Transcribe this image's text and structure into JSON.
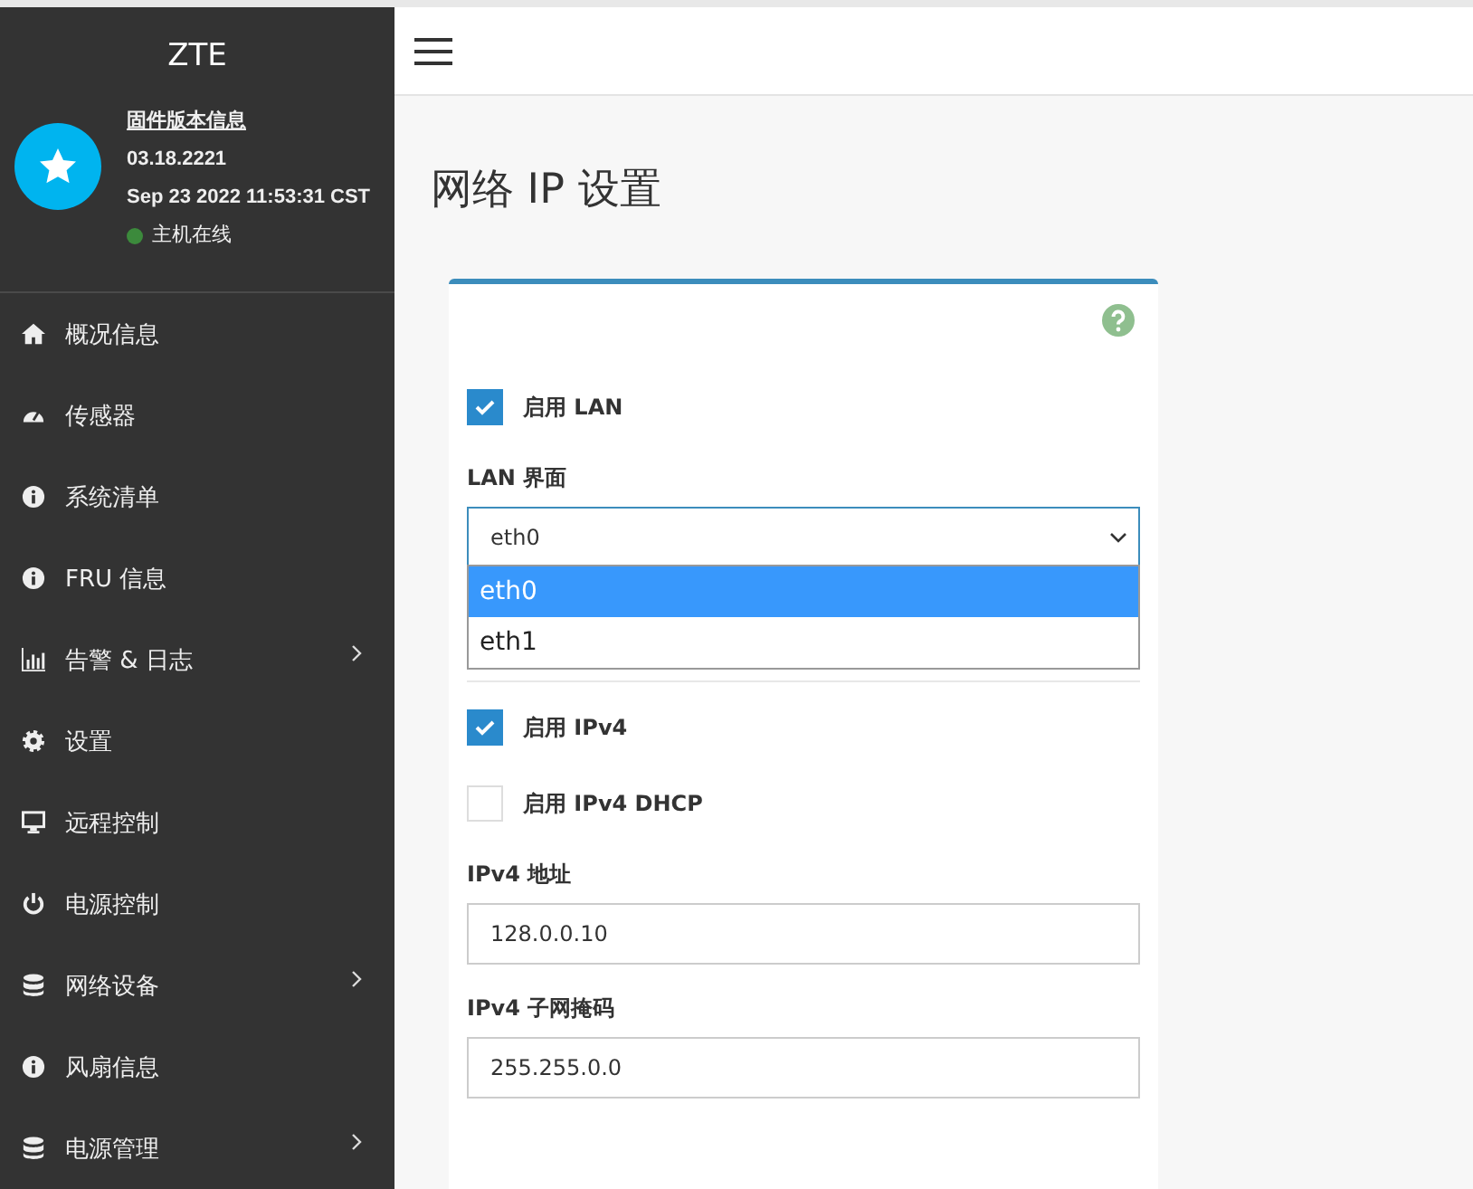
{
  "sidebar": {
    "brand": "ZTE",
    "profile": {
      "title": "固件版本信息",
      "version": "03.18.2221",
      "datetime": "Sep 23 2022 11:53:31 CST",
      "status": "主机在线"
    },
    "items": [
      {
        "label": "概况信息",
        "expandable": false
      },
      {
        "label": "传感器",
        "expandable": false
      },
      {
        "label": "系统清单",
        "expandable": false
      },
      {
        "label": "FRU 信息",
        "expandable": false
      },
      {
        "label": "告警 & 日志",
        "expandable": true
      },
      {
        "label": "设置",
        "expandable": false
      },
      {
        "label": "远程控制",
        "expandable": false
      },
      {
        "label": "电源控制",
        "expandable": false
      },
      {
        "label": "网络设备",
        "expandable": true
      },
      {
        "label": "风扇信息",
        "expandable": false
      },
      {
        "label": "电源管理",
        "expandable": true
      }
    ]
  },
  "page": {
    "title": "网络 IP 设置"
  },
  "form": {
    "enable_lan": {
      "label": "启用 LAN",
      "checked": true
    },
    "lan_interface": {
      "label": "LAN 界面",
      "value": "eth0",
      "options": [
        {
          "label": "eth0",
          "selected": true
        },
        {
          "label": "eth1",
          "selected": false
        }
      ]
    },
    "enable_ipv4": {
      "label": "启用 IPv4",
      "checked": true
    },
    "enable_ipv4_dhcp": {
      "label": "启用 IPv4 DHCP",
      "checked": false
    },
    "fields": [
      {
        "label": "IPv4 地址",
        "value": "128.0.0.10"
      },
      {
        "label": "IPv4 子网掩码",
        "value": "255.255.0.0"
      }
    ]
  }
}
